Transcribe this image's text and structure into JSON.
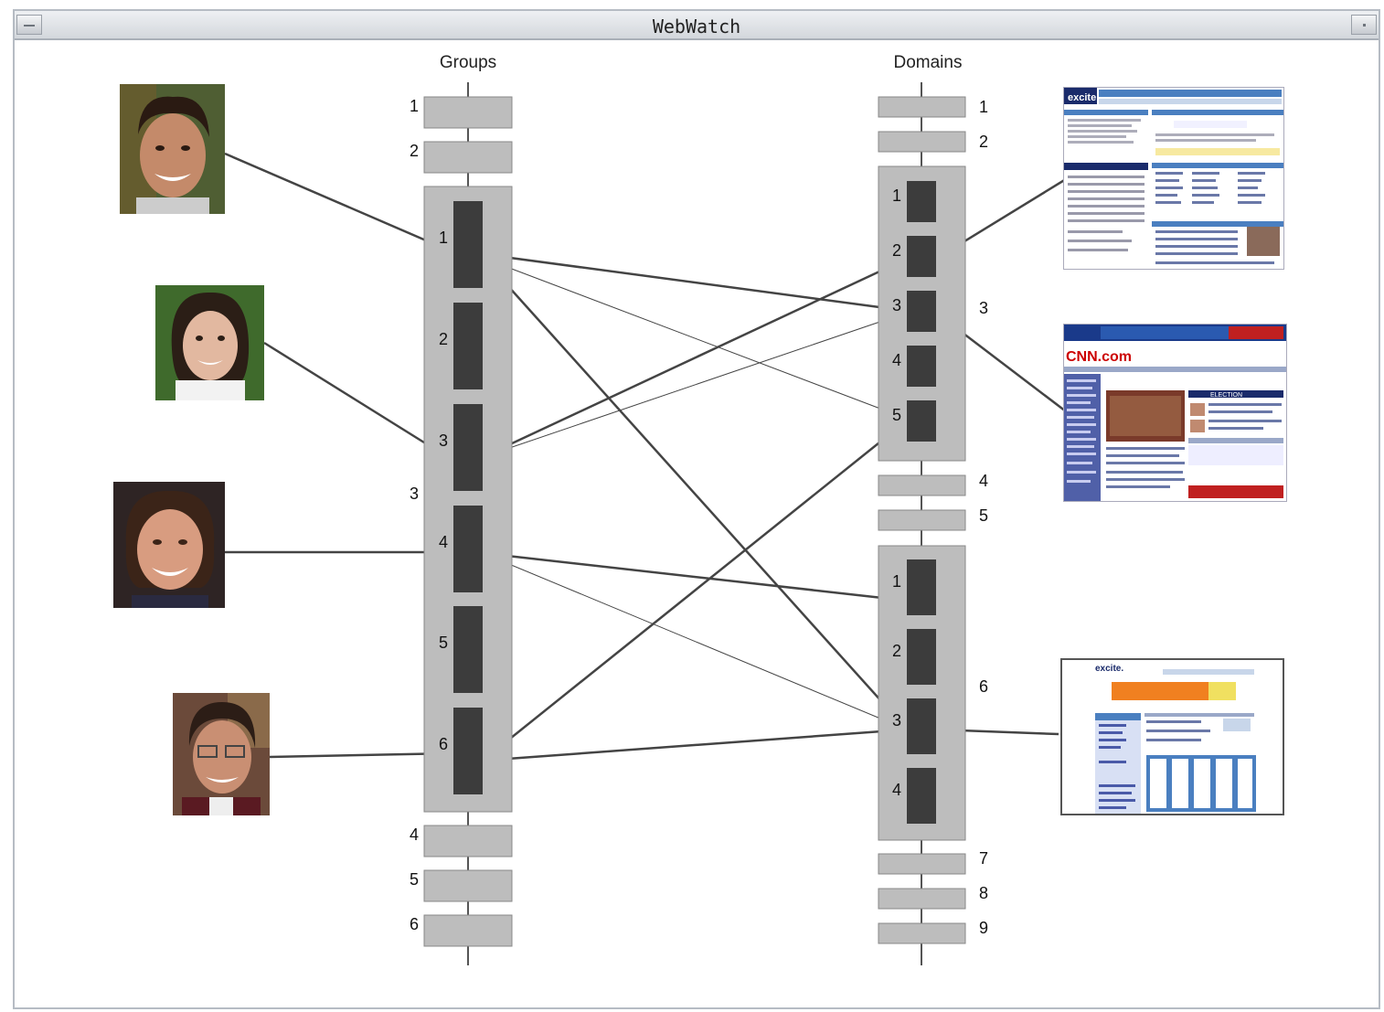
{
  "window": {
    "title": "WebWatch",
    "accent_bar": "#d3d7dc"
  },
  "groups_panel": {
    "header": "Groups",
    "top_items": [
      "1",
      "2"
    ],
    "expanded": {
      "label": "3",
      "subitems": [
        "1",
        "2",
        "3",
        "4",
        "5",
        "6"
      ]
    },
    "bottom_items": [
      "4",
      "5",
      "6"
    ]
  },
  "domains_panel": {
    "header": "Domains",
    "top_items": [
      "1",
      "2"
    ],
    "expanded_a": {
      "label": "3",
      "subitems": [
        "1",
        "2",
        "3",
        "4",
        "5"
      ]
    },
    "middle_items": [
      "4",
      "5"
    ],
    "expanded_b": {
      "label": "6",
      "subitems": [
        "1",
        "2",
        "3",
        "4"
      ]
    },
    "bottom_items": [
      "7",
      "8",
      "9"
    ]
  },
  "people": [
    {
      "name": "person-1",
      "skin": "#c48a6a",
      "hair": "#2a1a12",
      "bg": "#5a6b3a"
    },
    {
      "name": "person-2",
      "skin": "#e2b8a0",
      "hair": "#2b1e16",
      "bg": "#4a6b34"
    },
    {
      "name": "person-3",
      "skin": "#d89c80",
      "hair": "#3b2418",
      "bg": "#3a2a2a"
    },
    {
      "name": "person-4",
      "skin": "#c98f73",
      "hair": "#2c1d16",
      "bg": "#6b4a3a"
    }
  ],
  "websites": [
    {
      "name": "excite-portal-thumbnail",
      "logo": "excite"
    },
    {
      "name": "cnn-thumbnail",
      "logo": "CNN.com"
    },
    {
      "name": "excite-travel-thumbnail",
      "logo": "excite"
    }
  ],
  "colors": {
    "outer_box": "#bdbdbd",
    "inner_box": "#3c3c3c",
    "line": "#444444",
    "axis": "#555555"
  }
}
